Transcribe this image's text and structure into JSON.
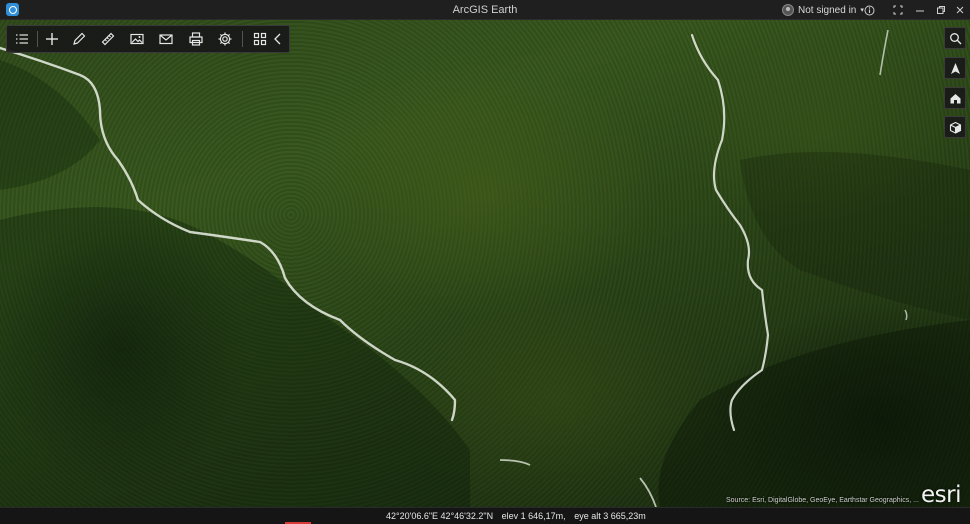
{
  "window": {
    "title": "ArcGIS Earth",
    "controls": [
      "minimize",
      "maximize",
      "close"
    ]
  },
  "user": {
    "signin_label": "Not signed in",
    "dropdown_icon": "chevron-down-icon"
  },
  "toolbar": {
    "tools": [
      {
        "name": "contents-button",
        "icon": "list-icon"
      },
      {
        "name": "add-data-button",
        "icon": "plus-icon"
      },
      {
        "name": "draw-button",
        "icon": "pencil-icon"
      },
      {
        "name": "measure-button",
        "icon": "ruler-icon"
      },
      {
        "name": "snapshot-button",
        "icon": "image-icon"
      },
      {
        "name": "share-button",
        "icon": "envelope-icon"
      },
      {
        "name": "print-button",
        "icon": "printer-icon"
      },
      {
        "name": "settings-button",
        "icon": "gear-icon"
      },
      {
        "name": "apps-button",
        "icon": "grid-icon"
      },
      {
        "name": "collapse-button",
        "icon": "chevron-left-icon"
      }
    ]
  },
  "nav": [
    {
      "name": "search-button",
      "icon": "search-icon"
    },
    {
      "name": "compass-button",
      "icon": "north-arrow-icon"
    },
    {
      "name": "home-button",
      "icon": "home-icon"
    },
    {
      "name": "view-3d-button",
      "icon": "cube-icon"
    }
  ],
  "map": {
    "attribution": "Source: Esri, DigitalGlobe, GeoEye, Earthstar Geographics, ...",
    "logo_text": "esri"
  },
  "status": {
    "coordinates": "42°20'06.6\"E 42°46'32.2\"N",
    "elevation": "elev 1 646,17m,",
    "eye_altitude": "eye alt 3 665,23m"
  },
  "colors": {
    "accent_blue": "#2f8fd8",
    "toolbar_bg": "#181818",
    "forest_green": "#2f4a1a"
  }
}
